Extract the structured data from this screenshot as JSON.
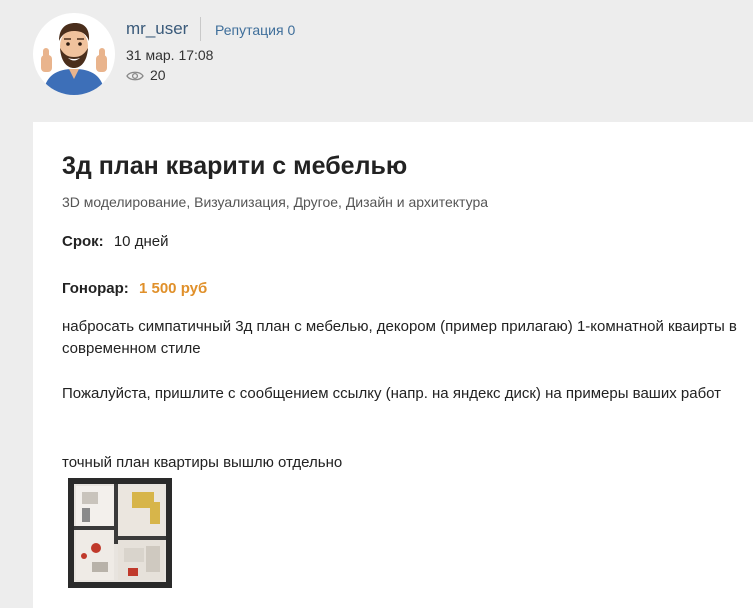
{
  "author": {
    "username": "mr_user",
    "reputation": "Репутация 0",
    "date": "31 мар. 17:08",
    "views": "20"
  },
  "post": {
    "title": "3д план кварити с мебелью",
    "categories": "3D моделирование, Визуализация, Другое, Дизайн и архитектура",
    "term_label": "Срок:",
    "term_value": "10 дней",
    "fee_label": "Гонорар:",
    "fee_value": "1 500 руб",
    "paragraphs": [
      "набросать симпатичный 3д план с мебелью, декором (пример прилагаю) 1-комнатной кваирты в современном стиле",
      "Пожалуйста, пришлите с сообщением ссылку (напр. на яндекс диск) на примеры ваших работ",
      "точный план квартиры вышлю отдельно"
    ]
  },
  "icons": {
    "avatar": "avatar",
    "views": "eye-icon",
    "attachment": "floorplan-thumbnail"
  },
  "colors": {
    "fee": "#e0902a",
    "link": "#3e6e9a",
    "background": "#ededed",
    "card": "#ffffff"
  }
}
